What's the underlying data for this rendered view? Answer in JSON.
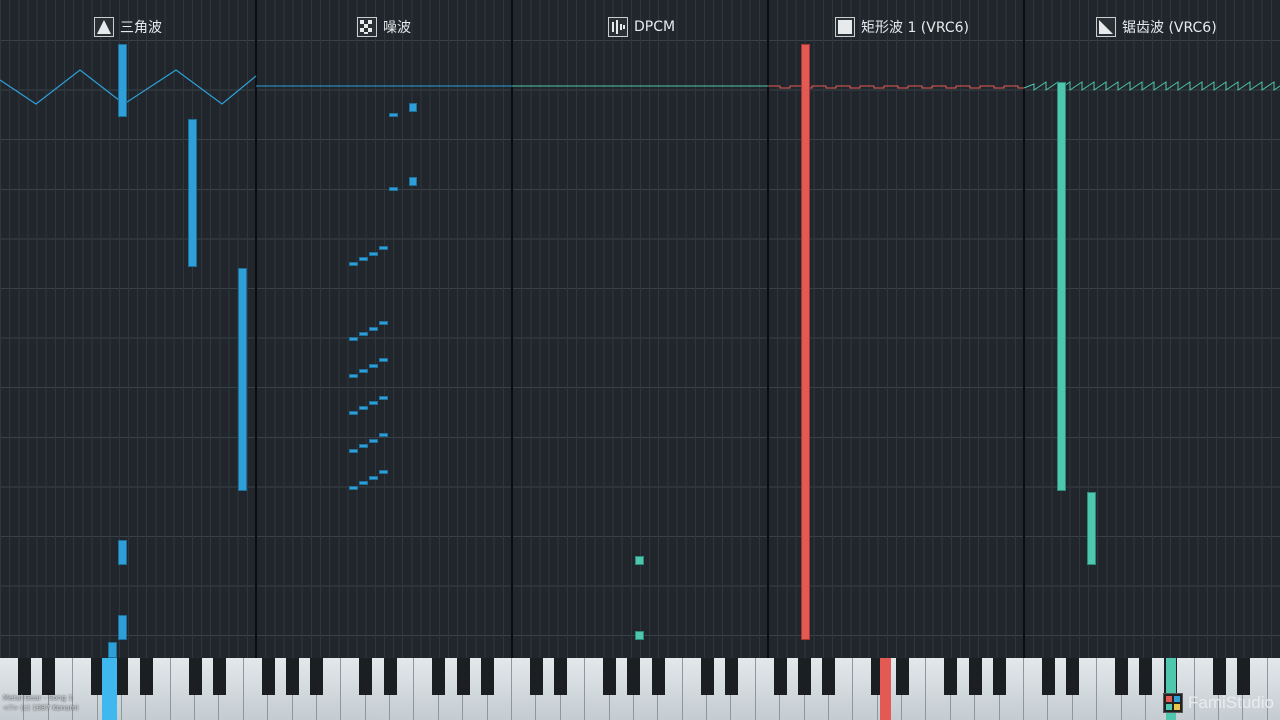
{
  "channels": [
    {
      "name": "三角波",
      "icon": "triangle-wave-icon",
      "color": "#2f9fd8"
    },
    {
      "name": "噪波",
      "icon": "noise-icon",
      "color": "#2f9fd8"
    },
    {
      "name": "DPCM",
      "icon": "dpcm-icon",
      "color": "#4fc6ae"
    },
    {
      "name": "矩形波 1 (VRC6)",
      "icon": "square-wave-icon",
      "color": "#e35a55"
    },
    {
      "name": "锯齿波 (VRC6)",
      "icon": "sawtooth-wave-icon",
      "color": "#4fc6ae"
    }
  ],
  "song_info": {
    "line1": "Metal Gear - Song 1",
    "line2": "<?> (c) 1987 Konami"
  },
  "brand": "FamiStudio"
}
